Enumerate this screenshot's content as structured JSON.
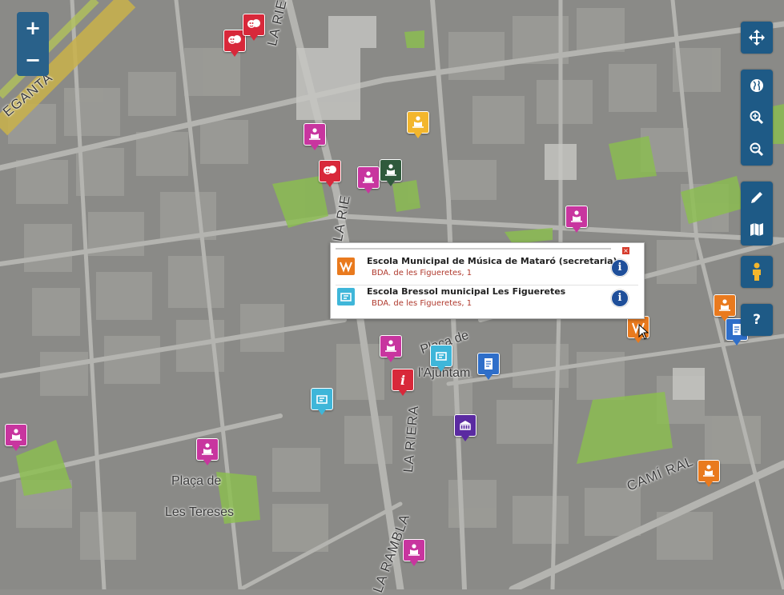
{
  "street_labels": {
    "la_riera_top": "LA RIERA",
    "la_riera_mid": "LA RIE",
    "la_riera_bottom": "LA RIERA",
    "la_rambla": "LA RAMBLA",
    "cami_ral": "CAMÍ RAL",
    "eganta": "EGANTA"
  },
  "square_labels": {
    "placa_teresas_line1": "Plaça de",
    "placa_teresas_line2": "Les Tereses",
    "placa_ajuntament_line1": "Plaça de",
    "placa_ajuntament_line2": "l'Ajuntam"
  },
  "zoom": {
    "in_label": "+",
    "out_label": "−"
  },
  "toolbar": {
    "pan_icon": "pan-arrows-icon",
    "globe_icon": "globe-icon",
    "zoom_in_icon": "magnifier-plus-icon",
    "zoom_out_icon": "magnifier-minus-icon",
    "draw_icon": "pencil-icon",
    "layers_icon": "folded-map-icon",
    "streetview_icon": "pegman-icon",
    "help_label": "?"
  },
  "popup": {
    "close_label": "×",
    "items": [
      {
        "title": "Escola Municipal de Música de Mataró (secretaria)",
        "address": "BDA. de les Figueretes, 1",
        "icon": "music-school-icon",
        "info_label": "i"
      },
      {
        "title": "Escola Bressol municipal Les Figueretes",
        "address": "BDA. de les Figueretes, 1",
        "icon": "nursery-school-icon",
        "info_label": "i"
      }
    ]
  },
  "colors": {
    "marker_magenta": "#c8359f",
    "marker_red": "#d8283a",
    "marker_orange": "#e97a1e",
    "marker_yellow": "#f3b62c",
    "marker_green": "#2f5a3c",
    "marker_cyan": "#3fb6d9",
    "marker_blue": "#2e6ec9",
    "marker_purple": "#5a2aa1",
    "control_blue": "#1e5a86"
  },
  "markers": [
    {
      "type": "theatre-icon",
      "color": "marker_red"
    },
    {
      "type": "theatre-icon",
      "color": "marker_red"
    },
    {
      "type": "library-icon",
      "color": "marker_magenta"
    },
    {
      "type": "library-icon",
      "color": "marker_yellow"
    },
    {
      "type": "theatre-icon",
      "color": "marker_red"
    },
    {
      "type": "library-icon",
      "color": "marker_magenta"
    },
    {
      "type": "library-icon",
      "color": "marker_green"
    },
    {
      "type": "library-icon",
      "color": "marker_magenta"
    },
    {
      "type": "library-icon",
      "color": "marker_orange"
    },
    {
      "type": "document-icon",
      "color": "marker_blue"
    },
    {
      "type": "music-school-icon",
      "color": "marker_orange"
    },
    {
      "type": "library-icon",
      "color": "marker_magenta"
    },
    {
      "type": "nursery-school-icon",
      "color": "marker_cyan"
    },
    {
      "type": "document-icon",
      "color": "marker_blue"
    },
    {
      "type": "info-icon",
      "color": "marker_red"
    },
    {
      "type": "nursery-school-icon",
      "color": "marker_cyan"
    },
    {
      "type": "museum-icon",
      "color": "marker_purple"
    },
    {
      "type": "library-icon",
      "color": "marker_magenta"
    },
    {
      "type": "library-icon",
      "color": "marker_magenta"
    },
    {
      "type": "library-icon",
      "color": "marker_orange"
    },
    {
      "type": "library-icon",
      "color": "marker_magenta"
    }
  ]
}
